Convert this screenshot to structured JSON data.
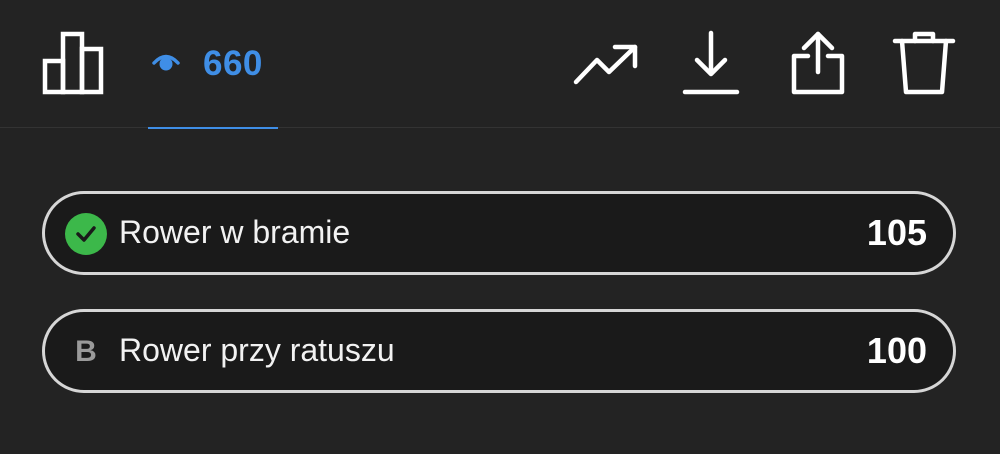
{
  "toolbar": {
    "stats_icon": "bar-chart-icon",
    "views_icon": "eye-icon",
    "views_count": "660",
    "trend_icon": "trending-up-icon",
    "download_icon": "download-icon",
    "share_icon": "share-icon",
    "delete_icon": "trash-icon",
    "accent_color": "#3f8ee6"
  },
  "options": [
    {
      "badge_type": "check",
      "badge_icon": "checkmark-icon",
      "badge_color": "#3cb84a",
      "label": "Rower w bramie",
      "votes": "105"
    },
    {
      "badge_type": "letter",
      "badge_text": "B",
      "label": "Rower przy ratuszu",
      "votes": "100"
    }
  ]
}
